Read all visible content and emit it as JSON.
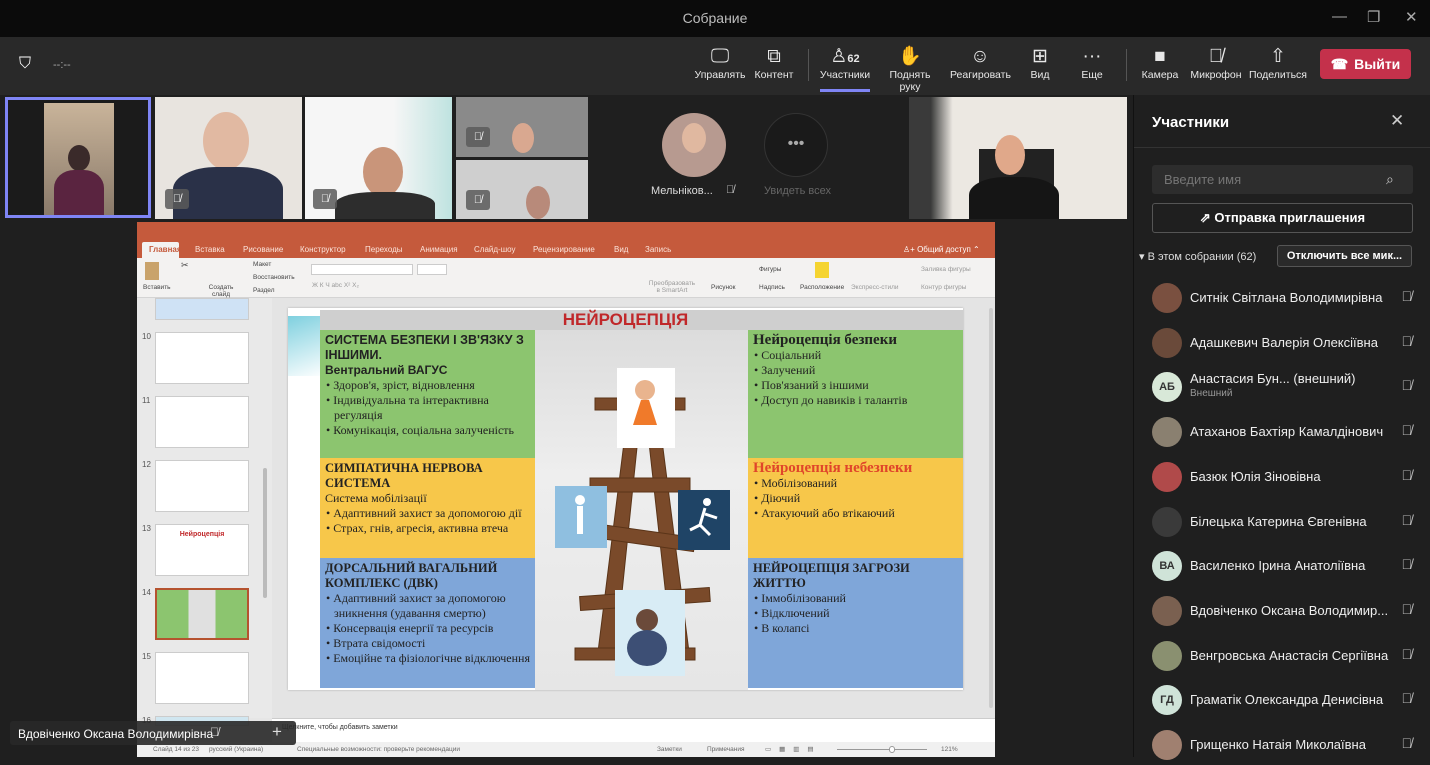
{
  "window": {
    "title": "Собрание",
    "timer": "--:--"
  },
  "toolbar": {
    "items": [
      {
        "label": "Управлять",
        "icon": "screen-pointer-icon"
      },
      {
        "label": "Контент",
        "icon": "share-content-icon"
      },
      {
        "label": "Участники",
        "icon": "people-icon",
        "count": "62"
      },
      {
        "label": "Поднять руку",
        "icon": "hand-icon"
      },
      {
        "label": "Реагировать",
        "icon": "smile-icon"
      },
      {
        "label": "Вид",
        "icon": "grid-icon"
      },
      {
        "label": "Еще",
        "icon": "more-icon"
      },
      {
        "label": "Камера",
        "icon": "camera-icon"
      },
      {
        "label": "Микрофон",
        "icon": "mic-off-icon"
      },
      {
        "label": "Поделиться",
        "icon": "share-icon"
      }
    ],
    "leave": "Выйти"
  },
  "gallery": {
    "avatar_name": "Мельніков...",
    "see_all": "Увидеть всех"
  },
  "ppt": {
    "tabs": [
      "Главная",
      "Вставка",
      "Рисование",
      "Конструктор",
      "Переходы",
      "Анимация",
      "Слайд-шоу",
      "Рецензирование",
      "Вид",
      "Запись"
    ],
    "share": "Общий доступ",
    "ribbon": {
      "paste": "Вставить",
      "new_slide": "Создать слайд",
      "layout": "Макет",
      "reset": "Восстановить",
      "section": "Раздел",
      "smartart": "Преобразовать в SmartArt",
      "picture": "Рисунок",
      "shapes": "Фигуры",
      "textbox": "Надпись",
      "arrange": "Расположение",
      "quick_styles": "Экспресс-стили",
      "fill": "Заливка фигуры",
      "outline": "Контур фигуры"
    },
    "thumb_numbers": [
      "10",
      "11",
      "12",
      "13",
      "14",
      "15",
      "16"
    ],
    "thumb13_title": "Нейроцепція",
    "notes_placeholder": "Щелкните, чтобы добавить заметки",
    "status": {
      "slide": "Слайд 14 из 23",
      "lang": "русский (Украина)",
      "access": "Специальные возможности: проверьте рекомендации",
      "notes": "Заметки",
      "comments": "Примечания",
      "zoom": "121%"
    },
    "slide": {
      "title": "НЕЙРОЦЕПЦІЯ",
      "left": [
        {
          "heading": "СИСТЕМА БЕЗПЕКИ І ЗВ'ЯЗКУ З ІНШИМИ.",
          "sub": "Вентральний ВАГУС",
          "items": [
            "Здоров'я, зріст, відновлення",
            "Індивідуальна та інтерактивна регуляція",
            "Комунікація, соціальна залученість"
          ]
        },
        {
          "heading": "СИМПАТИЧНА НЕРВОВА СИСТЕМА",
          "sub": "Система мобілізації",
          "items": [
            "Адаптивний захист за допомогою дії",
            "Страх, гнів, агресія, активна втеча"
          ]
        },
        {
          "heading": "ДОРСАЛЬНИЙ ВАГАЛЬНИЙ КОМПЛЕКС (ДВК)",
          "items": [
            "Адаптивний захист за допомогою зникнення (удавання смертю)",
            "Консервація енергії та ресурсів",
            "Втрата свідомості",
            "Емоційне та фізіологічне відключення"
          ]
        }
      ],
      "right": [
        {
          "heading": "Нейроцепція безпеки",
          "items": [
            "Соціальний",
            "Залучений",
            "Пов'язаний з іншими",
            "Доступ до навиків і талантів"
          ]
        },
        {
          "heading": "Нейроцепція небезпеки",
          "items": [
            "Мобілізований",
            "Діючий",
            "Атакуючий або втікаючий"
          ]
        },
        {
          "heading": "НЕЙРОЦЕПЦІЯ ЗАГРОЗИ ЖИТТЮ",
          "items": [
            "Іммобілізований",
            "Відключений",
            "В колапсі"
          ]
        }
      ]
    }
  },
  "presenter_tag": "Вдовіченко Оксана Володимирівна",
  "panel": {
    "title": "Участники",
    "search_placeholder": "Введите имя",
    "invite": "Отправка приглашения",
    "section": "В этом собрании (62)",
    "mute_all": "Отключить все мик...",
    "people": [
      {
        "name": "Ситнік Світлана Володимирівна"
      },
      {
        "name": "Адашкевич Валерія Олексіївна"
      },
      {
        "name": "Анастасия Бун... (внешний)",
        "initials": "АБ",
        "sub": "Внешний"
      },
      {
        "name": "Атаханов Бахтіяр Камалдінович"
      },
      {
        "name": "Базюк Юлія Зіновівна"
      },
      {
        "name": "Білецька Катерина Євгенівна"
      },
      {
        "name": "Василенко Ірина Анатоліївна",
        "initials": "ВА"
      },
      {
        "name": "Вдовіченко Оксана Володимир..."
      },
      {
        "name": "Венгровська Анастасія Сергіївна"
      },
      {
        "name": "Граматік Олександра Денисівна",
        "initials": "ГД"
      },
      {
        "name": "Грищенко Натаія Миколаївна"
      }
    ]
  },
  "colors": {
    "accent": "#7f85f5",
    "leave": "#c4314b",
    "ppt": "#c55a3c",
    "green": "#8cc56f",
    "yellow": "#f7c74a",
    "blue": "#7fa6d9"
  }
}
